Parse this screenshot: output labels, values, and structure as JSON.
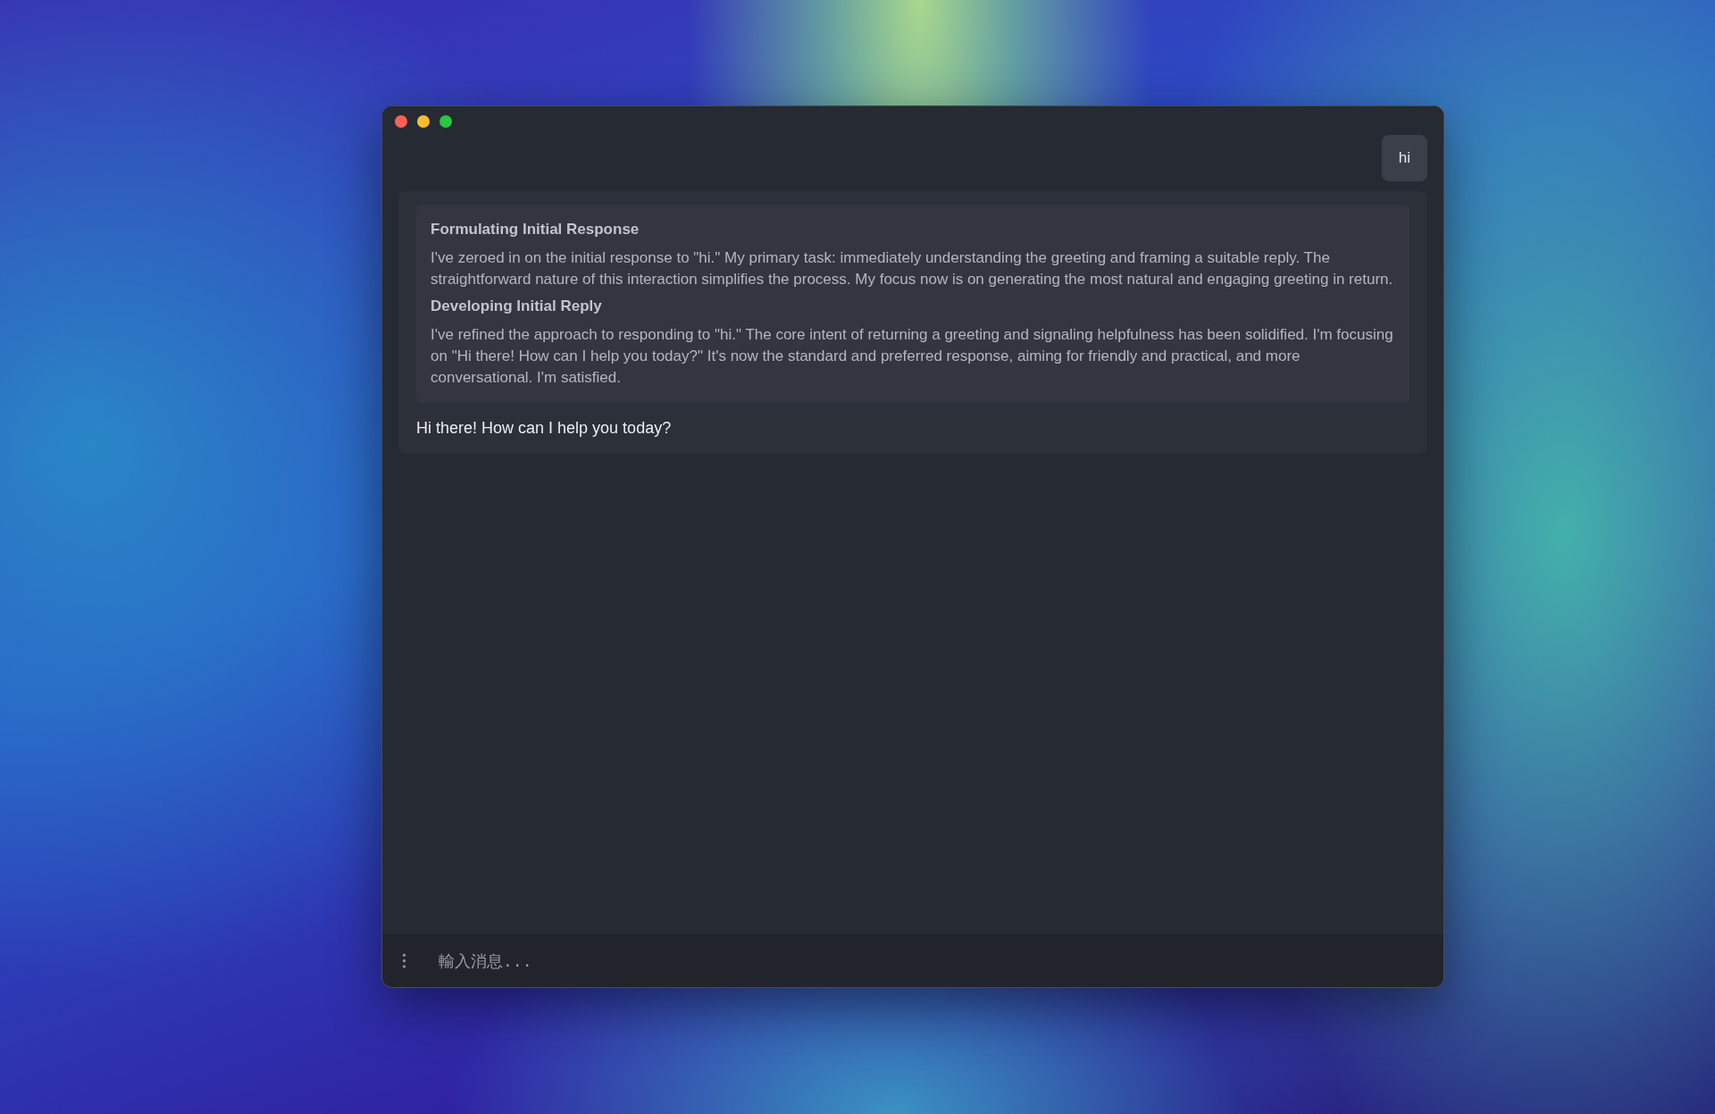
{
  "messages": [
    {
      "kind": "user",
      "text": "hi"
    },
    {
      "kind": "assistant",
      "thoughts": [
        {
          "heading": "Formulating Initial Response",
          "body": "I've zeroed in on the initial response to \"hi.\" My primary task: immediately understanding the greeting and framing a suitable reply. The straightforward nature of this interaction simplifies the process. My focus now is on generating the most natural and engaging greeting in return."
        },
        {
          "heading": "Developing Initial Reply",
          "body": "I've refined the approach to responding to \"hi.\" The core intent of returning a greeting and signaling helpfulness has been solidified. I'm focusing on \"Hi there! How can I help you today?\" It's now the standard and preferred response, aiming for friendly and practical, and more conversational. I'm satisfied."
        }
      ],
      "text": "Hi there! How can I help you today?"
    }
  ],
  "composer": {
    "placeholder": "輸入消息..."
  }
}
